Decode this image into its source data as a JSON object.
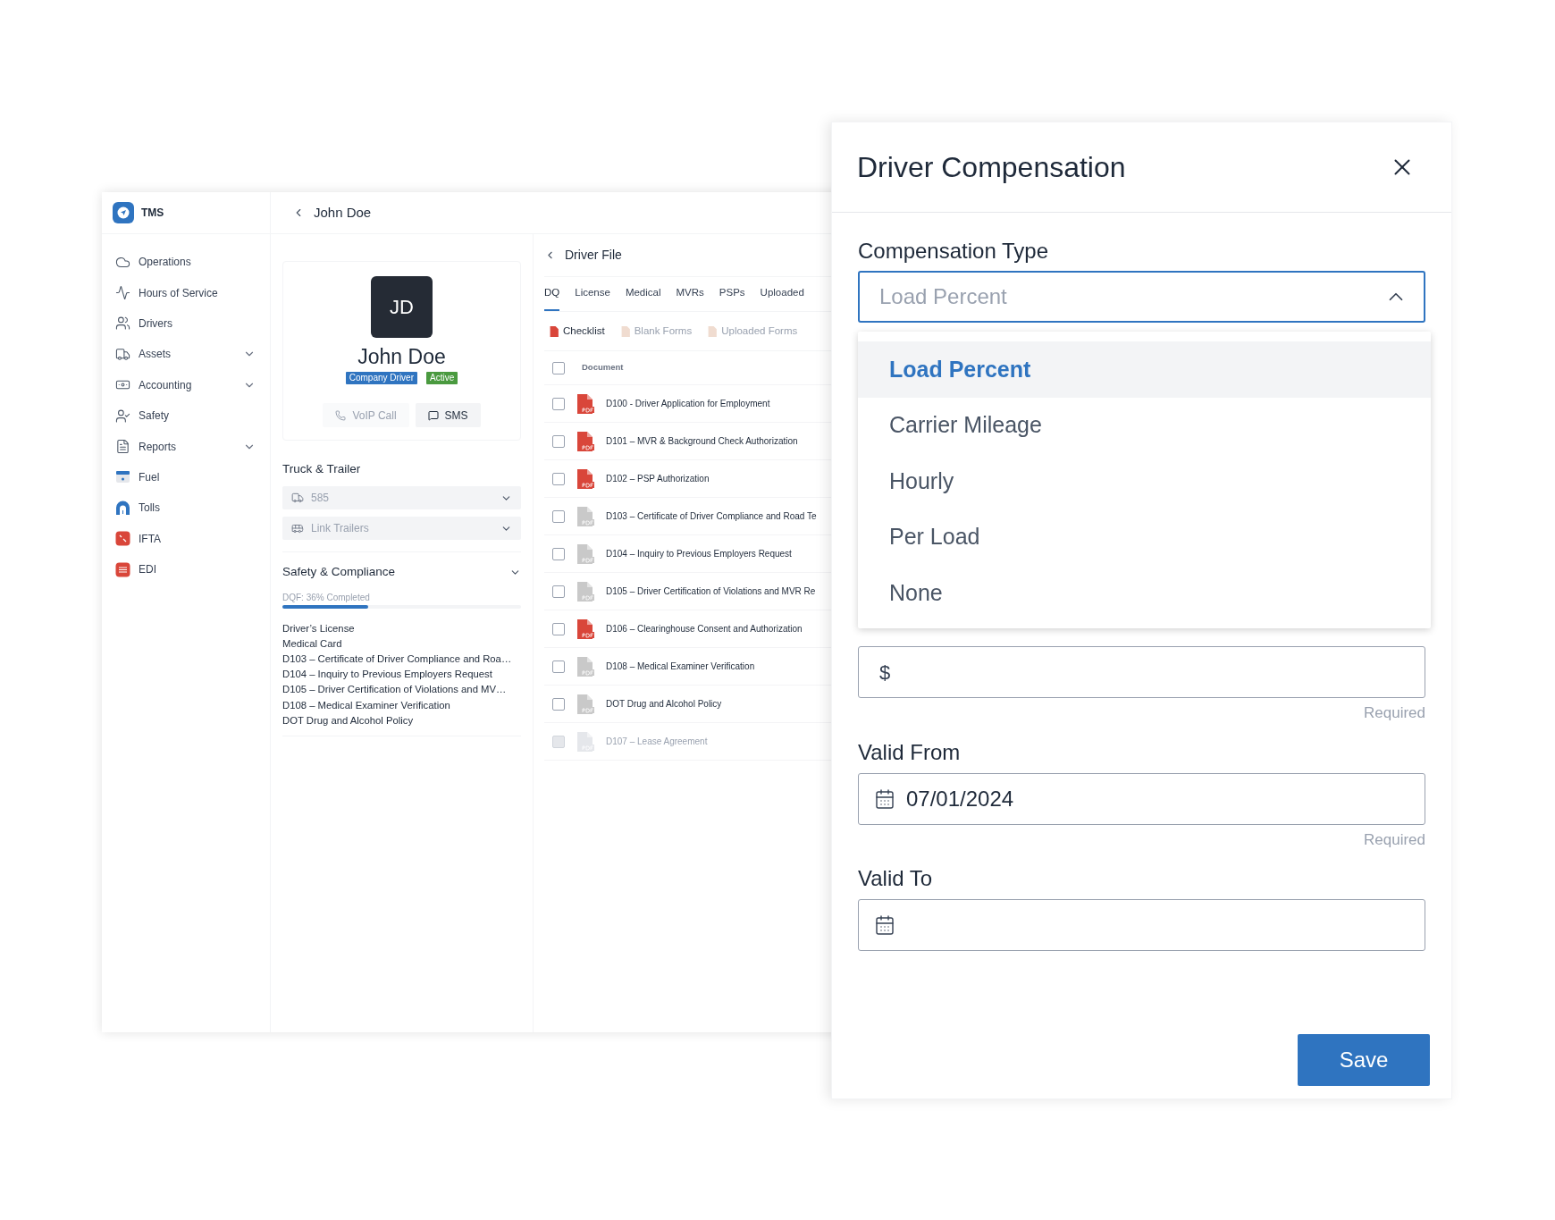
{
  "app": {
    "brand": "TMS",
    "sidebar": {
      "items": [
        {
          "label": "Operations",
          "expandable": false
        },
        {
          "label": "Hours of Service",
          "expandable": false
        },
        {
          "label": "Drivers",
          "expandable": false
        },
        {
          "label": "Assets",
          "expandable": true
        },
        {
          "label": "Accounting",
          "expandable": true
        },
        {
          "label": "Safety",
          "expandable": false
        },
        {
          "label": "Reports",
          "expandable": true
        },
        {
          "label": "Fuel",
          "expandable": false
        },
        {
          "label": "Tolls",
          "expandable": false
        },
        {
          "label": "IFTA",
          "expandable": false
        },
        {
          "label": "EDI",
          "expandable": false
        }
      ]
    },
    "header": {
      "title": "John Doe"
    },
    "profile": {
      "initials": "JD",
      "name": "John Doe",
      "badges": [
        {
          "label": "Company Driver",
          "color": "#2f74c0"
        },
        {
          "label": "Active",
          "color": "#4a9a3f"
        }
      ],
      "buttons": [
        {
          "label": "VoIP Call",
          "disabled": true
        },
        {
          "label": "SMS",
          "disabled": false
        }
      ]
    },
    "truck_trailer": {
      "title": "Truck & Trailer",
      "truck": {
        "value": "585",
        "disabled": true
      },
      "trailers": {
        "placeholder": "Link Trailers",
        "disabled": true
      }
    },
    "safety": {
      "title": "Safety & Compliance",
      "expanded": true,
      "progress_label": "DQF: 36% Completed",
      "level": 0.36,
      "items": [
        "Driver’s License",
        "Medical Card",
        "D103 – Certificate of Driver Compliance and Roa…",
        "D104 – Inquiry to Previous Employers Request",
        "D105 – Driver Certification of Violations and MV…",
        "D108 – Medical Examiner Verification",
        "DOT Drug and Alcohol Policy"
      ]
    },
    "driver_file": {
      "title": "Driver File",
      "tabs": [
        {
          "label": "DQ",
          "selected": true
        },
        {
          "label": "License",
          "selected": false
        },
        {
          "label": "Medical",
          "selected": false
        },
        {
          "label": "MVRs",
          "selected": false
        },
        {
          "label": "PSPs",
          "selected": false
        },
        {
          "label": "Uploaded",
          "selected": false
        }
      ],
      "views": [
        {
          "label": "Checklist",
          "selected": true
        },
        {
          "label": "Blank Forms",
          "selected": false
        },
        {
          "label": "Uploaded Forms",
          "selected": false
        }
      ],
      "table": {
        "column": "Document",
        "header_checked": false,
        "rows": [
          {
            "name": "D100 - Driver Application for Employment",
            "uploaded": true,
            "checked": false,
            "disabled": false
          },
          {
            "name": "D101 – MVR & Background Check Authorization",
            "uploaded": true,
            "checked": false,
            "disabled": false
          },
          {
            "name": "D102 – PSP Authorization",
            "uploaded": true,
            "checked": false,
            "disabled": false
          },
          {
            "name": "D103 – Certificate of Driver Compliance and Road Te",
            "uploaded": false,
            "checked": false,
            "disabled": false
          },
          {
            "name": "D104 – Inquiry to Previous Employers Request",
            "uploaded": false,
            "checked": false,
            "disabled": false
          },
          {
            "name": "D105 – Driver Certification of Violations and MVR Re",
            "uploaded": false,
            "checked": false,
            "disabled": false
          },
          {
            "name": "D106 – Clearinghouse Consent and Authorization",
            "uploaded": true,
            "checked": false,
            "disabled": false
          },
          {
            "name": "D108 – Medical Examiner Verification",
            "uploaded": false,
            "checked": false,
            "disabled": false
          },
          {
            "name": "DOT Drug and Alcohol Policy",
            "uploaded": false,
            "checked": false,
            "disabled": false
          },
          {
            "name": "D107 – Lease Agreement",
            "uploaded": false,
            "checked": false,
            "disabled": true
          }
        ]
      }
    }
  },
  "modal": {
    "title": "Driver Compensation",
    "compensation_type": {
      "label": "Compensation Type",
      "value": "Load Percent",
      "expanded": true,
      "options": [
        {
          "label": "Load Percent",
          "selected": true
        },
        {
          "label": "Carrier Mileage",
          "selected": false
        },
        {
          "label": "Hourly",
          "selected": false
        },
        {
          "label": "Per Load",
          "selected": false
        },
        {
          "label": "None",
          "selected": false
        }
      ]
    },
    "extra_stop_rate": {
      "prefix": "$",
      "hint": "Required"
    },
    "valid_from": {
      "label": "Valid From",
      "value": "07/01/2024",
      "hint": "Required"
    },
    "valid_to": {
      "label": "Valid To"
    },
    "save_button": "Save"
  }
}
